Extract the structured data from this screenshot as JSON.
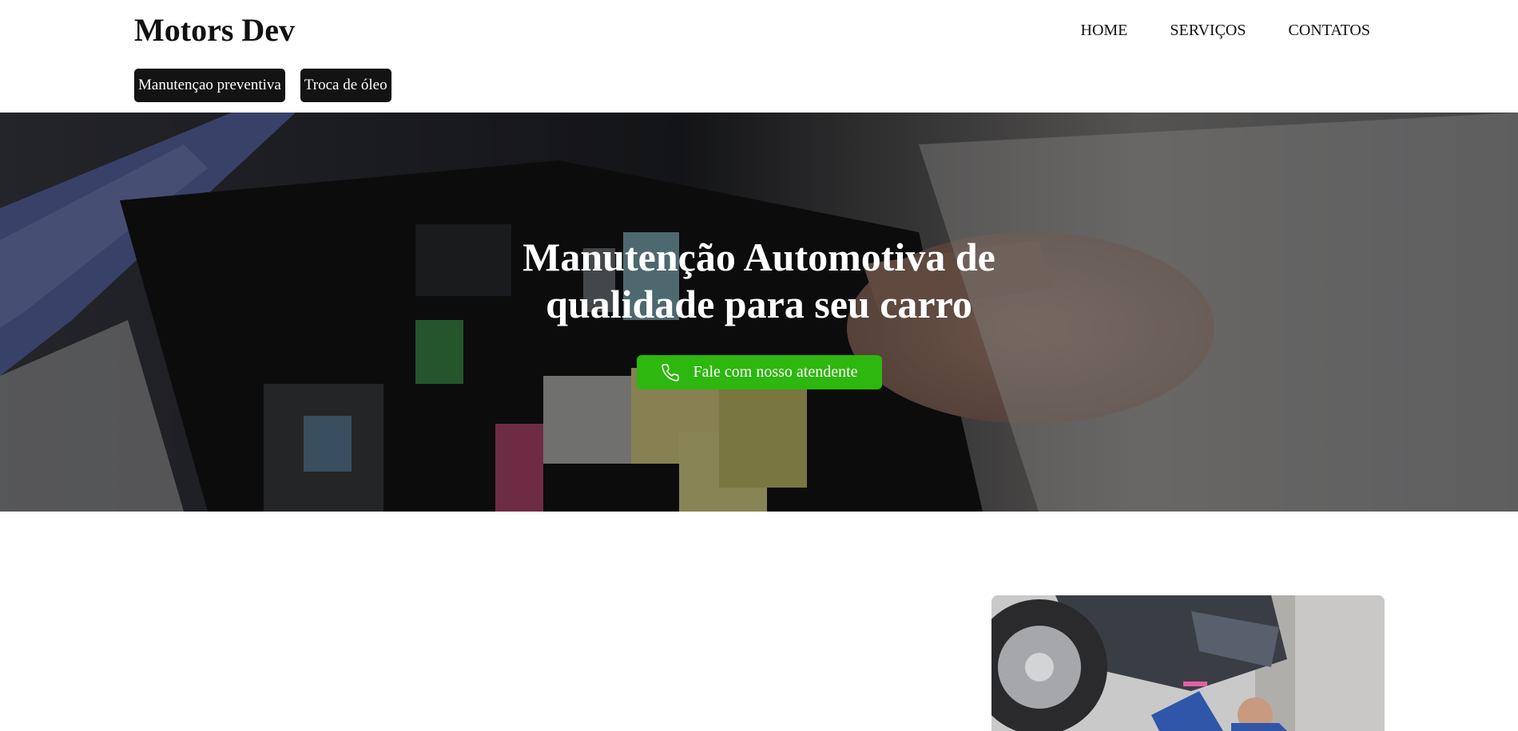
{
  "header": {
    "logo": "Motors Dev",
    "nav": [
      {
        "label": "HOME"
      },
      {
        "label": "SERVIÇOS"
      },
      {
        "label": "CONTATOS"
      }
    ],
    "tags": [
      {
        "label": "Manutençao preventiva"
      },
      {
        "label": "Troca de óleo"
      }
    ]
  },
  "hero": {
    "title": "Manutenção Automotiva de qualidade para seu carro",
    "cta_label": "Fale com nosso atendente",
    "cta_icon": "phone-icon",
    "cta_color": "#2db70f",
    "background_image": "engine-fuse-box-photo"
  },
  "section": {
    "image": "mechanic-under-car-photo"
  }
}
